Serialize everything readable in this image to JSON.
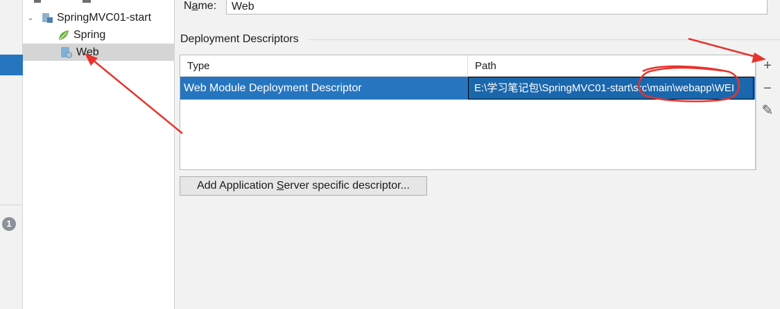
{
  "tree": {
    "items": [
      {
        "label": "SpringMVC01-start",
        "icon": "module-icon",
        "expanded": true
      },
      {
        "label": "Spring",
        "icon": "spring-leaf-icon"
      },
      {
        "label": "Web",
        "icon": "web-facet-icon",
        "selected": true
      }
    ]
  },
  "left_strip": {
    "badge": "1"
  },
  "form": {
    "name_label_prefix": "N",
    "name_label_underlined": "a",
    "name_label_suffix": "me:",
    "name_value": "Web"
  },
  "deployment": {
    "section_title": "Deployment Descriptors",
    "columns": [
      "Type",
      "Path"
    ],
    "rows": [
      {
        "type": "Web Module Deployment Descriptor",
        "path": "E:\\学习笔记包\\SpringMVC01-start\\src\\main\\webapp\\WEI"
      }
    ],
    "tools": {
      "add": "+",
      "remove": "−",
      "edit": "✎"
    }
  },
  "add_button": {
    "prefix": "Add Application ",
    "underlined": "S",
    "suffix": "erver specific descriptor..."
  },
  "colors": {
    "selection": "#2675bf",
    "annotation_red": "#e8322c"
  }
}
